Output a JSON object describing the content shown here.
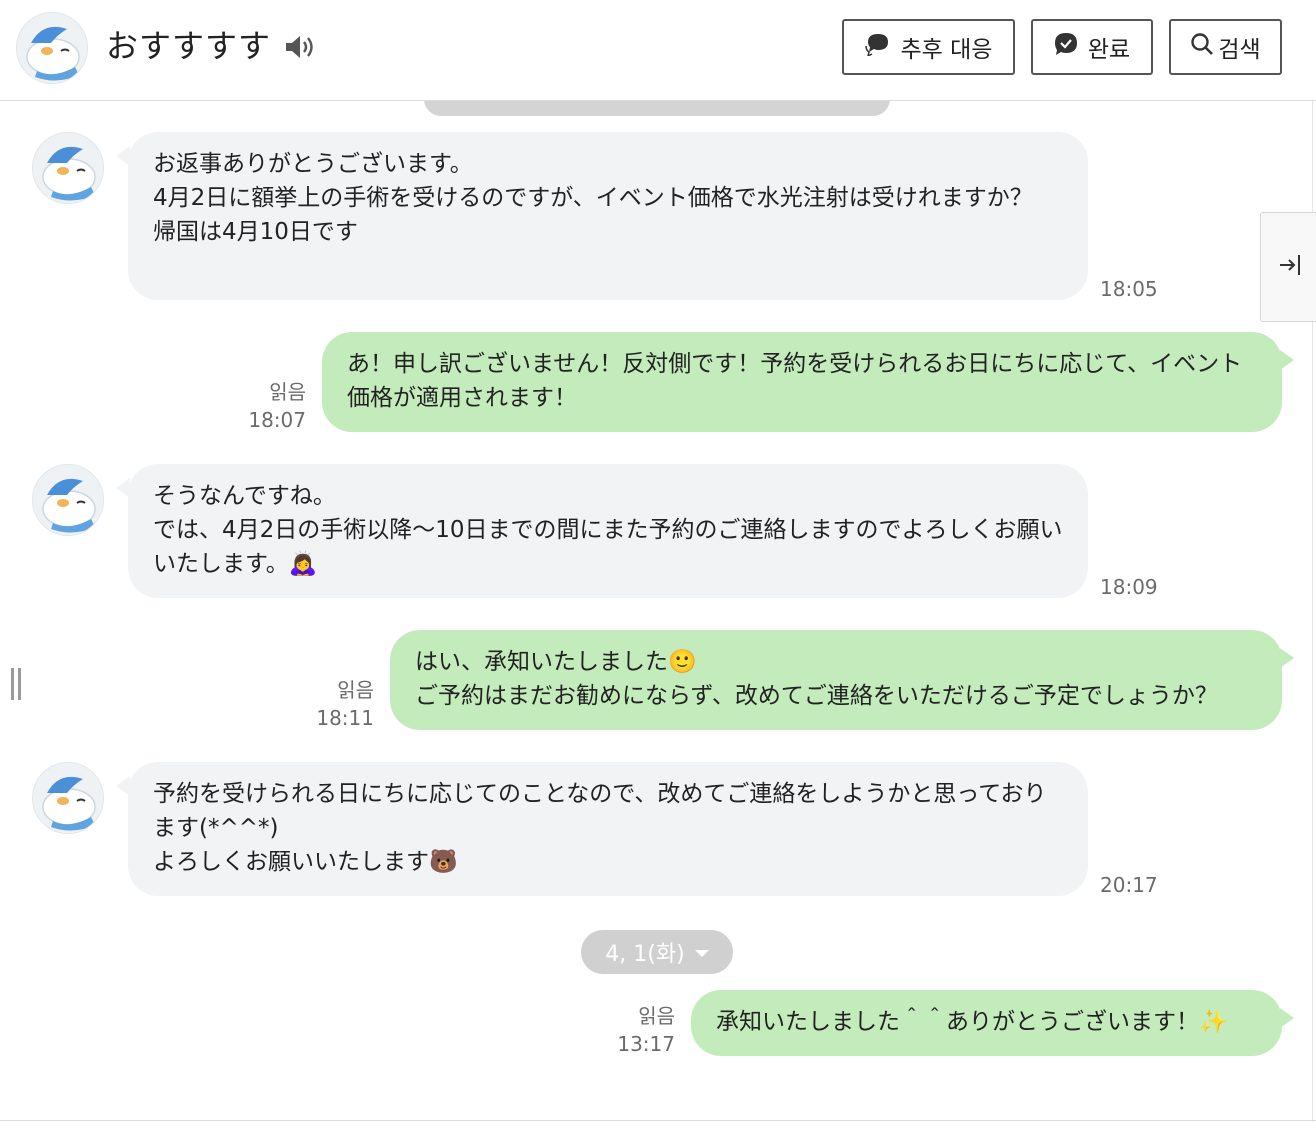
{
  "header": {
    "title": "おすすすす",
    "buttons": {
      "followup": "추후 대응",
      "done": "완료",
      "search": "검색"
    }
  },
  "messages": [
    {
      "direction": "in",
      "text": "お返事ありがとうございます。\n4月2日に額挙上の手術を受けるのですが、イベント価格で水光注射は受けれますか？\n帰国は4月10日です",
      "time": "18:05"
    },
    {
      "direction": "out",
      "text": "あ！申し訳ございません！反対側です！予約を受けられるお日にちに応じて、イベント価格が適用されます！",
      "read": "읽음",
      "time": "18:07"
    },
    {
      "direction": "in",
      "text": "そうなんですね。\nでは、4月2日の手術以降～10日までの間にまた予約のご連絡しますのでよろしくお願いいたします。🙇‍♀️",
      "time": "18:09"
    },
    {
      "direction": "out",
      "text": "はい、承知いたしました🙂\nご予約はまだお勧めにならず、改めてご連絡をいただけるご予定でしょうか？",
      "read": "읽음",
      "time": "18:11"
    },
    {
      "direction": "in",
      "text": "予約を受けられる日にちに応じてのことなので、改めてご連絡をしようかと思っております(*^^*)\nよろしくお願いいたします🐻",
      "time": "20:17"
    },
    {
      "direction": "out",
      "text": "承知いたしました＾＾ありがとうございます！✨",
      "read": "읽음",
      "time": "13:17"
    }
  ],
  "date_divider": "4, 1(화)",
  "icons": {
    "speaker": "speaker-icon",
    "followup": "chat-bubbles-icon",
    "done": "check-circle-icon",
    "search": "search-icon",
    "collapse": "collapse-right-icon",
    "drag": "drag-handle-icon"
  },
  "colors": {
    "incoming_bubble": "#f2f3f5",
    "outgoing_bubble": "#c4ebbc",
    "date_pill": "#d0d0d0"
  }
}
